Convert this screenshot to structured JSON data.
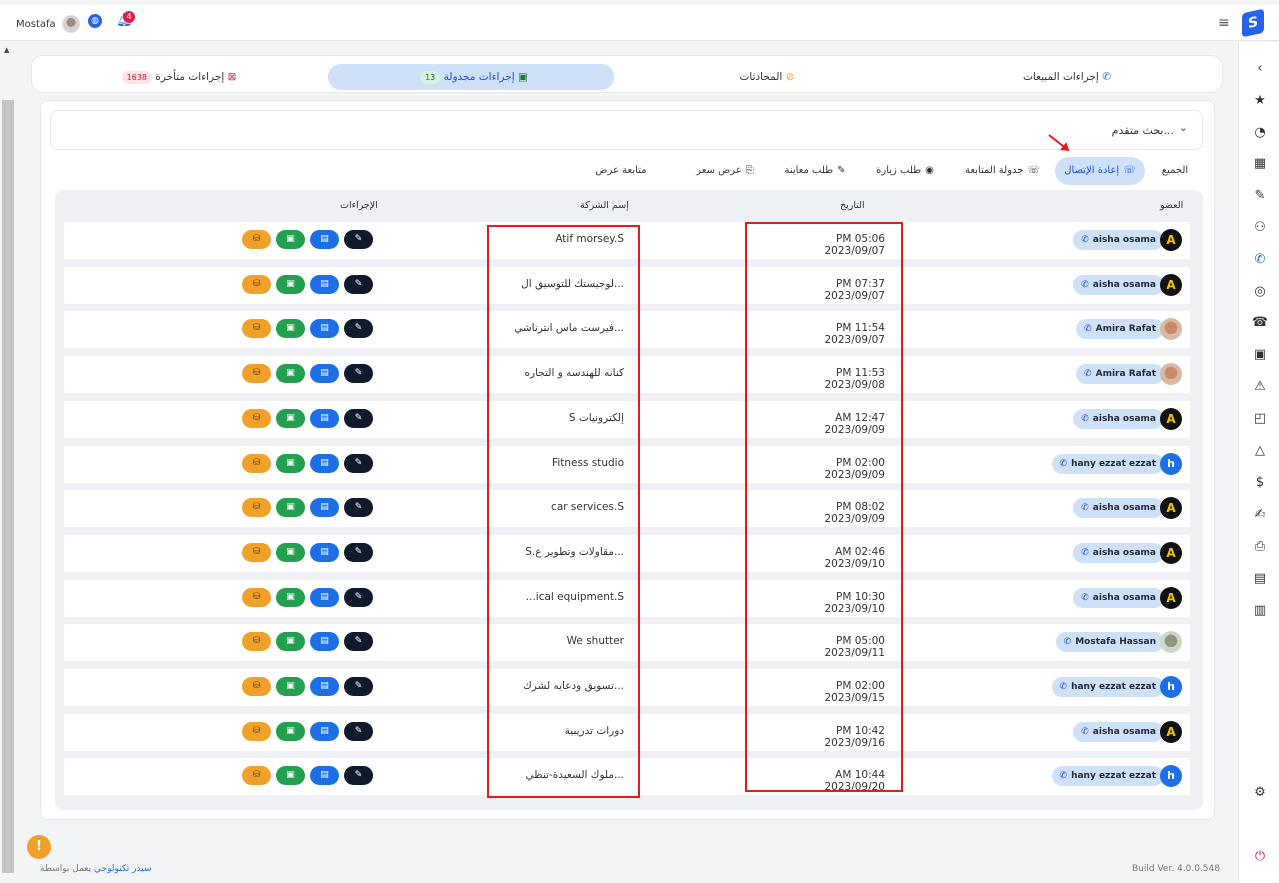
{
  "topbar": {
    "user_name": "Mostafa",
    "notification_count": "4"
  },
  "tabs": [
    {
      "label": "إجراءات متأخرة",
      "badge": "1638",
      "icon": "calendar-x-icon"
    },
    {
      "label": "إجراءات مجدولة",
      "badge": "13",
      "icon": "calendar-check-icon",
      "active": true
    },
    {
      "label": "المحادثات",
      "icon": "chat-off-icon"
    },
    {
      "label": "إجراءات المبيعات",
      "icon": "phone-icon"
    }
  ],
  "advanced_search": "بحث متقدم...",
  "subtabs": [
    {
      "label": "متابعة عرض السعر",
      "icon": "quote-icon"
    },
    {
      "label": "عرض سعر",
      "icon": "quote-icon"
    },
    {
      "label": "طلب معاينة",
      "icon": "pen-icon"
    },
    {
      "label": "طلب زيارة",
      "icon": "eye-icon"
    },
    {
      "label": "جدولة المتابعة",
      "icon": "phone-icon"
    },
    {
      "label": "إعادة الإتصال",
      "icon": "phone-icon",
      "active": true
    },
    {
      "label": "الجميع"
    }
  ],
  "table": {
    "headers": {
      "member": "العضو",
      "date": "التاريخ",
      "company": "إسم الشركة",
      "actions": "الإجراءات"
    },
    "rows": [
      {
        "member": "aisha osama",
        "avatar": "A",
        "date": "PM 05:06 2023/09/07",
        "company": "Atif morsey.S"
      },
      {
        "member": "aisha osama",
        "avatar": "A",
        "date": "PM 07:37 2023/09/07",
        "company": "لوجيستك للتوسيق ال..."
      },
      {
        "member": "Amira Rafat",
        "avatar": "photo",
        "date": "PM 11:54 2023/09/07",
        "company": "فيرست ماس انترناشي..."
      },
      {
        "member": "Amira Rafat",
        "avatar": "photo",
        "date": "PM 11:53 2023/09/08",
        "company": "كنانه للهندسه و التجاره"
      },
      {
        "member": "aisha osama",
        "avatar": "A",
        "date": "AM 12:47 2023/09/09",
        "company": "S إلكترونيات"
      },
      {
        "member": "hany ezzat ezzat",
        "avatar": "h",
        "date": "PM 02:00 2023/09/09",
        "company": "Fitness studio"
      },
      {
        "member": "aisha osama",
        "avatar": "A",
        "date": "PM 08:02 2023/09/09",
        "company": "car services.S"
      },
      {
        "member": "aisha osama",
        "avatar": "A",
        "date": "AM 02:46 2023/09/10",
        "company": "S.مقاولات وتطوير ع..."
      },
      {
        "member": "aisha osama",
        "avatar": "A",
        "date": "PM 10:30 2023/09/10",
        "company": "...ical equipment.S"
      },
      {
        "member": "Mostafa Hassan",
        "avatar": "photo2",
        "date": "PM 05:00 2023/09/11",
        "company": "We shutter"
      },
      {
        "member": "hany ezzat ezzat",
        "avatar": "h",
        "date": "PM 02:00 2023/09/15",
        "company": "تسويق ودعايه لشرك..."
      },
      {
        "member": "aisha osama",
        "avatar": "A",
        "date": "PM 10:42 2023/09/16",
        "company": "دورات تدريبية"
      },
      {
        "member": "hany ezzat ezzat",
        "avatar": "h",
        "date": "AM 10:44 2023/09/20",
        "company": "ملوك السعيدة-تنظي..."
      }
    ]
  },
  "footer": {
    "powered_prefix": "يعمل بواسطة",
    "powered_name": "سيدر تكنولوجي",
    "build": "Build Ver. 4.0.0.548"
  },
  "colors": {
    "accent": "#1d6fe8",
    "active_tab_bg": "#cfe0f9",
    "highlight_box": "#e11d1d"
  }
}
